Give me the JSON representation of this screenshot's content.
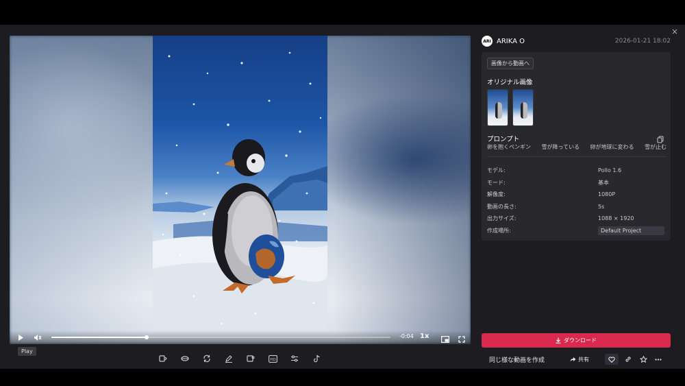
{
  "modal": {
    "close_icon": "×"
  },
  "player": {
    "time_remaining": "-0:04",
    "speed": "1x",
    "progress_fraction": 0.28,
    "tooltip": "Play"
  },
  "user": {
    "name": "ARIKA O",
    "avatar_text": "ARI",
    "date": "2026-01-21 18:02"
  },
  "card": {
    "chip": "画像から動画へ",
    "original_title": "オリジナル画像",
    "prompt_title": "プロンプト",
    "prompt_tags": [
      "卵を抱くペンギン",
      "雪が降っている",
      "卵が地球に変わる",
      "雪が止む"
    ],
    "meta": [
      {
        "key": "モデル:",
        "value": "Pollo 1.6"
      },
      {
        "key": "モード:",
        "value": "基本"
      },
      {
        "key": "解像度:",
        "value": "1080P"
      },
      {
        "key": "動画の長さ:",
        "value": "5s"
      },
      {
        "key": "出力サイズ:",
        "value": "1088 × 1920"
      },
      {
        "key": "作成場所:",
        "value": "Default Project"
      }
    ]
  },
  "actions": {
    "download": "ダウンロード",
    "create_similar": "同じ様な動画を作成",
    "share": "共有"
  },
  "colors": {
    "accent": "#d9294f",
    "panel_bg": "#1d1d21",
    "card_bg": "#28282d"
  }
}
